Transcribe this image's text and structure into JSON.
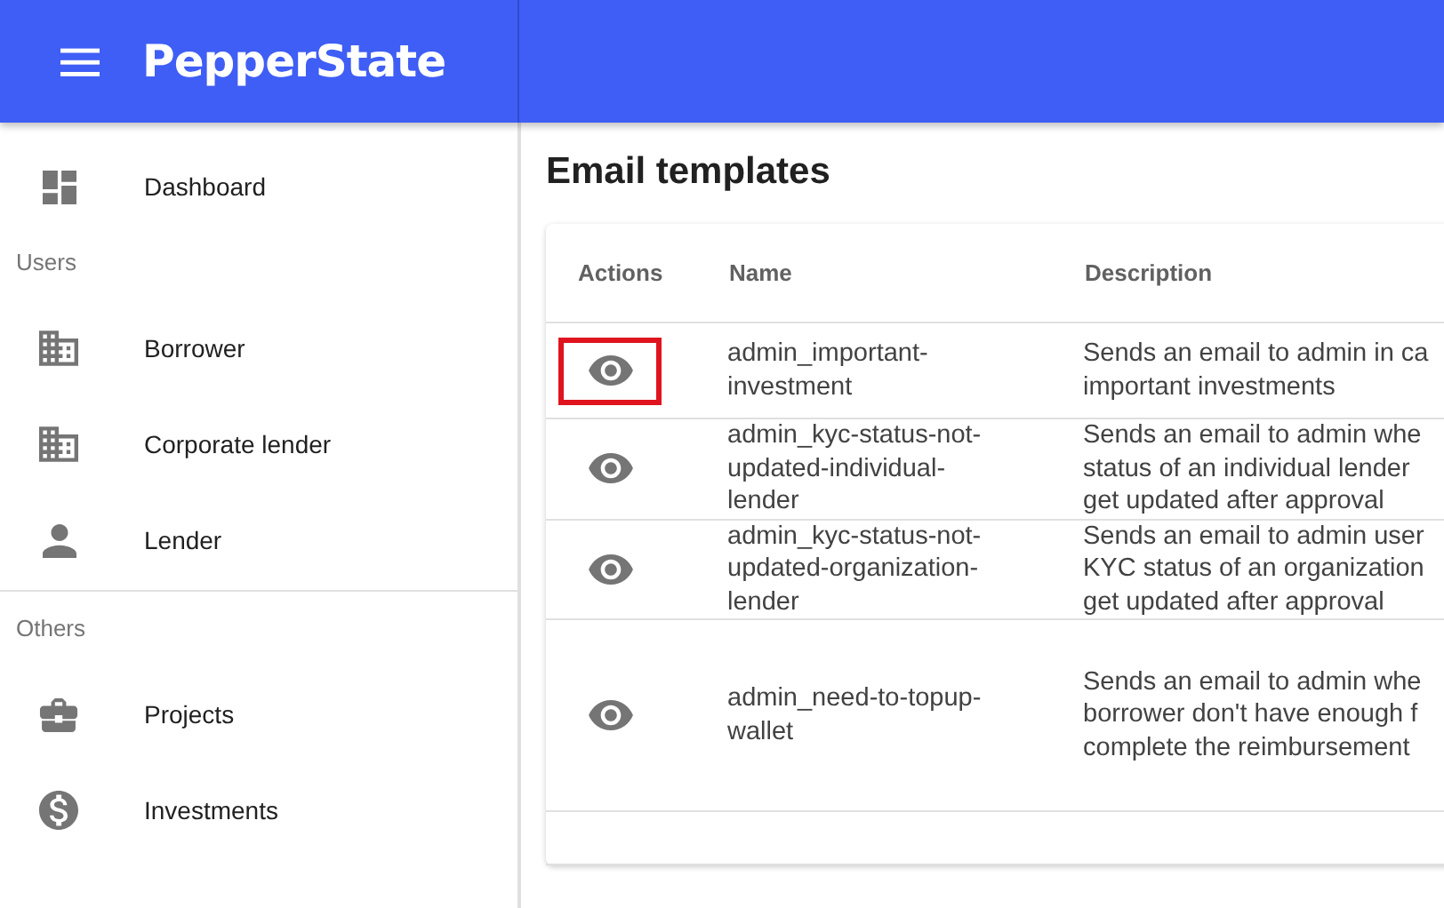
{
  "app_bar": {
    "logo": "PepperState"
  },
  "sidebar": {
    "sections": [
      {
        "items": [
          {
            "label": "Dashboard",
            "kind": "dashboard"
          }
        ]
      },
      {
        "heading": "Users",
        "divider_above": false,
        "items": [
          {
            "label": "Borrower",
            "kind": "building"
          },
          {
            "label": "Corporate lender",
            "kind": "building"
          },
          {
            "label": "Lender",
            "kind": "person"
          }
        ]
      },
      {
        "heading": "Others",
        "divider_above": true,
        "items": [
          {
            "label": "Projects",
            "kind": "briefcase"
          },
          {
            "label": "Investments",
            "kind": "dollar"
          }
        ]
      }
    ]
  },
  "page_title": "Email templates",
  "table": {
    "columns": [
      "Actions",
      "Name",
      "Description"
    ],
    "rows": [
      {
        "highlighted": true,
        "name_lines": [
          "admin_important-",
          "investment"
        ],
        "description_lines": [
          "Sends an email to admin in ca",
          "important investments"
        ]
      },
      {
        "highlighted": false,
        "name_lines": [
          "admin_kyc-status-not-",
          "updated-individual-",
          "lender"
        ],
        "description_lines": [
          "Sends an email to admin whe",
          "status of an individual lender",
          "get updated after approval"
        ]
      },
      {
        "highlighted": false,
        "name_lines": [
          "admin_kyc-status-not-",
          "updated-organization-",
          "lender"
        ],
        "description_lines": [
          "Sends an email to admin user",
          "KYC status of an organization",
          "get updated after approval"
        ]
      },
      {
        "highlighted": false,
        "name_lines": [
          "admin_need-to-topup-",
          "wallet"
        ],
        "description_lines": [
          "Sends an email to admin whe",
          "borrower don't have enough f",
          "complete the reimbursement"
        ]
      }
    ]
  }
}
